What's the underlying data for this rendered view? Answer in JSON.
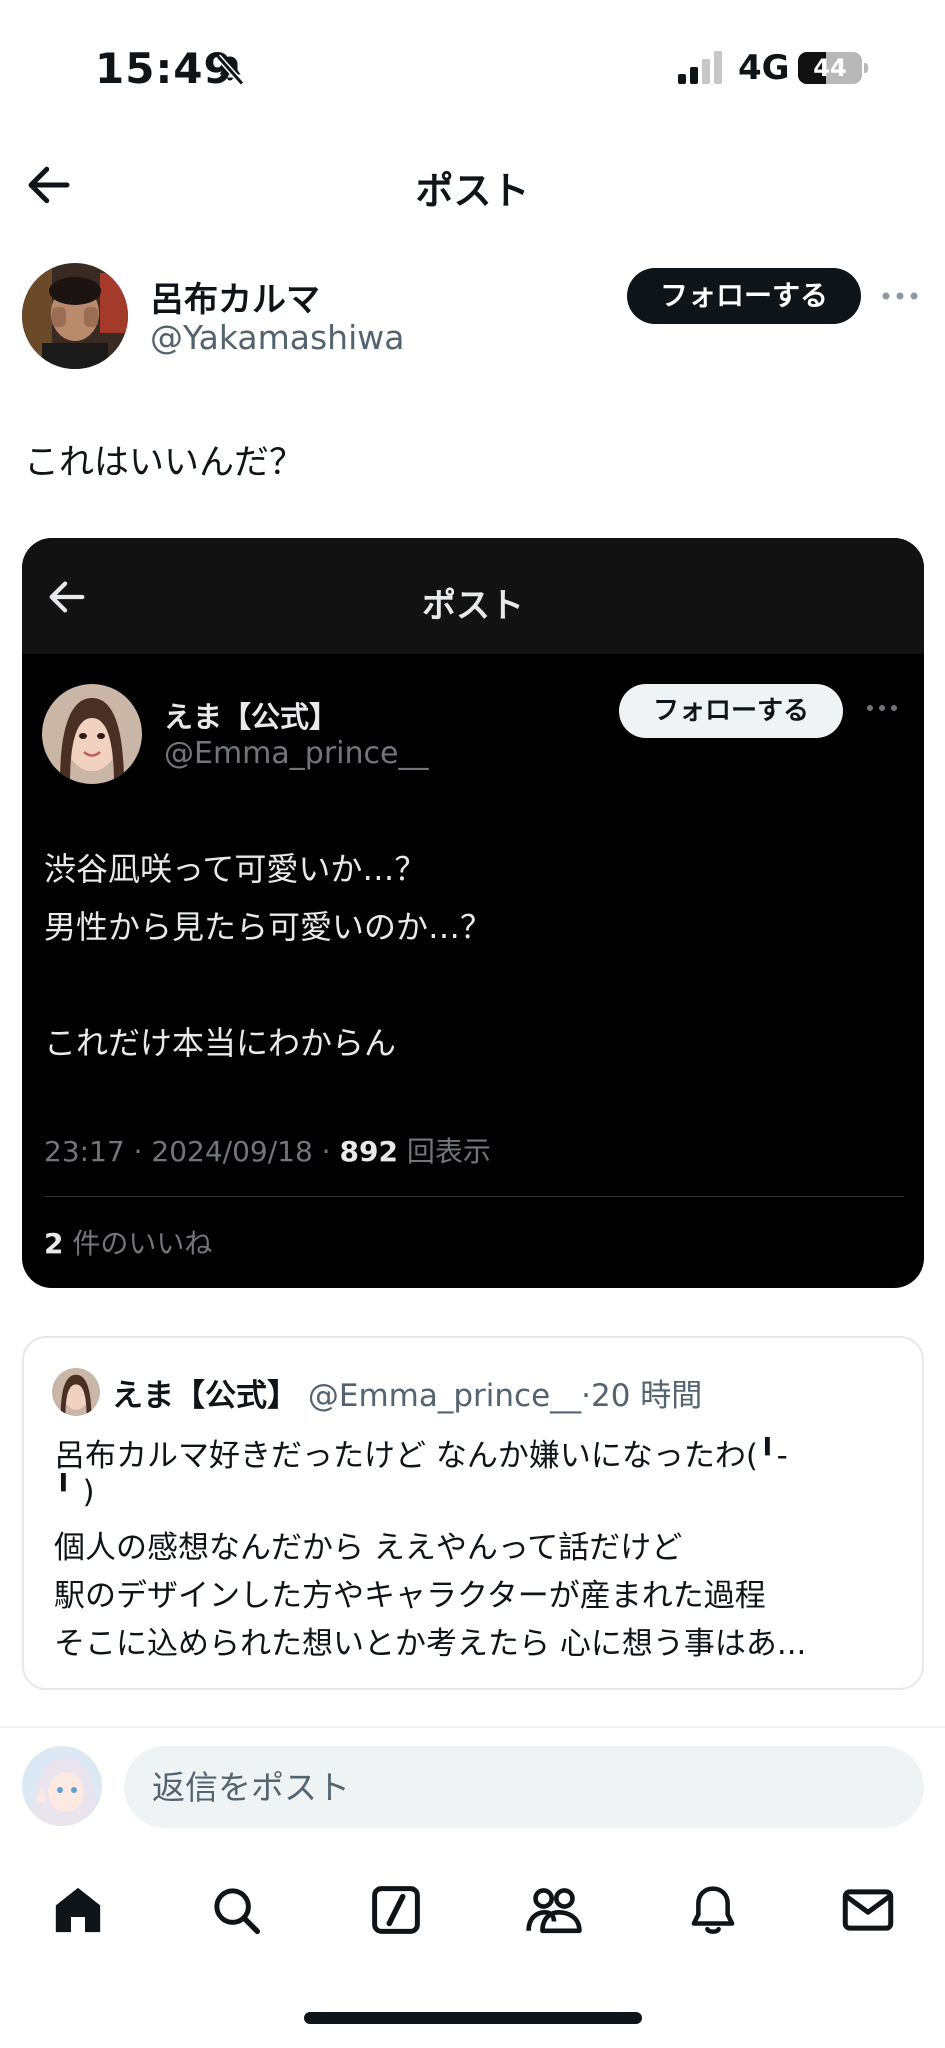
{
  "status_bar": {
    "time": "15:49",
    "network": "4G",
    "battery_percent": "44",
    "battery_level": 0.44,
    "icons": [
      "bell-slash-icon",
      "signal-icon",
      "battery-icon"
    ]
  },
  "nav": {
    "title": "ポスト",
    "back_icon": "arrow-left-icon"
  },
  "post": {
    "author_name": "呂布カルマ",
    "author_handle": "@Yakamashiwa",
    "follow_label": "フォローする",
    "text": "これはいいんだ？"
  },
  "screenshot": {
    "nav_title": "ポスト",
    "author_name": "えま【公式】",
    "author_handle": "@Emma_prince__",
    "follow_label": "フォローする",
    "lines": [
      "渋谷凪咲って可愛いか…？",
      "男性から見たら可愛いのか…？",
      "",
      "これだけ本当にわからん"
    ],
    "meta_time": "23:17 · 2024/09/18 · ",
    "views_count": "892",
    "views_label": "回表示",
    "likes_count": "2",
    "likes_label": "件のいいね"
  },
  "quote": {
    "author_name": "えま【公式】",
    "author_handle": "@Emma_prince__",
    "separator": "·",
    "time": "20 時間",
    "lines": [
      "呂布カルマ好きだったけど なんか嫌いになったわ(╹-",
      "╹ )",
      "個人の感想なんだから ええやんって話だけど",
      "駅のデザインした方やキャラクターが産まれた過程",
      "そこに込められた想いとか考えたら 心に想う事はあ..."
    ]
  },
  "reply": {
    "placeholder": "返信をポスト"
  },
  "tabbar": {
    "items": [
      {
        "icon": "home-icon",
        "active": true
      },
      {
        "icon": "search-icon",
        "active": false
      },
      {
        "icon": "grok-icon",
        "active": false
      },
      {
        "icon": "communities-icon",
        "active": false
      },
      {
        "icon": "bell-icon",
        "active": false
      },
      {
        "icon": "mail-icon",
        "active": false
      }
    ]
  },
  "colors": {
    "text": "#0f1419",
    "secondary": "#536471",
    "dark_card": "#000000",
    "dark_text": "#e7e9ea",
    "dark_secondary": "#71767b"
  }
}
